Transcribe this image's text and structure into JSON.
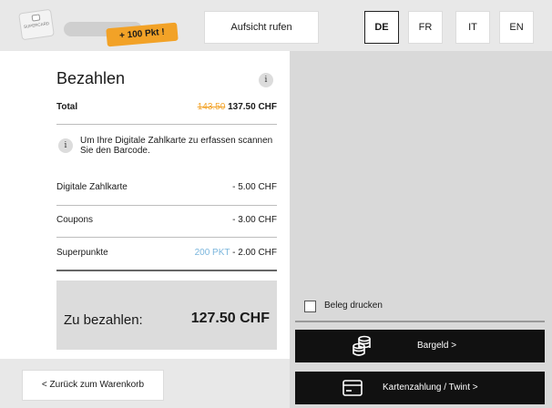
{
  "header": {
    "card_label": "SUPERCARD",
    "points_badge": "+ 100 Pkt !",
    "call_supervisor": "Aufsicht rufen",
    "languages": [
      "DE",
      "FR",
      "IT",
      "EN"
    ],
    "selected_language": "DE"
  },
  "payment": {
    "title": "Bezahlen",
    "info_icon": "i",
    "total_label": "Total",
    "total_original": "143.50",
    "total_value": "137.50 CHF",
    "hint": "Um Ihre Digitale Zahlkarte zu erfassen scannen Sie den Barcode.",
    "items": [
      {
        "label": "Digitale Zahlkarte",
        "value": "- 5.00 CHF"
      },
      {
        "label": "Coupons",
        "value": "- 3.00 CHF"
      },
      {
        "label": "Superpunkte",
        "points": "200 PKT",
        "value": "- 2.00 CHF"
      }
    ],
    "due_label": "Zu bezahlen:",
    "due_value": "127.50 CHF"
  },
  "options": {
    "print_receipt": "Beleg drucken",
    "print_receipt_checked": false
  },
  "actions": {
    "cash": "Bargeld >",
    "card": "Kartenzahlung / Twint >",
    "back": "< Zurück zum Warenkorb"
  },
  "icons": {
    "cash": "coins-icon",
    "card": "credit-card-icon",
    "info": "info-icon"
  },
  "colors": {
    "accent": "#f2a227",
    "points": "#7bb6dd",
    "primary_button": "#111111"
  }
}
